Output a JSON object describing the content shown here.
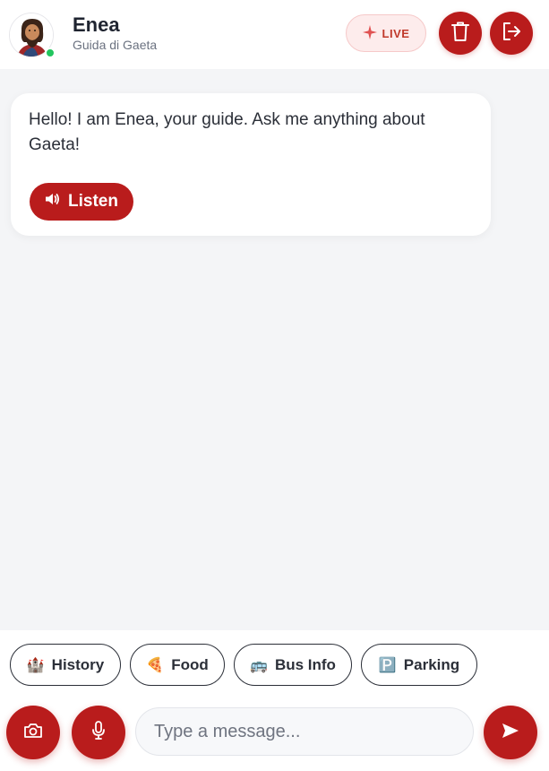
{
  "header": {
    "name": "Enea",
    "subtitle": "Guida di Gaeta",
    "live_label": "LIVE",
    "online": true
  },
  "chat": {
    "messages": [
      {
        "sender": "bot",
        "text": "Hello! I am Enea, your guide. Ask me anything about Gaeta!",
        "listen_label": "Listen"
      }
    ]
  },
  "quick_replies": [
    {
      "emoji": "🏰",
      "label": "History"
    },
    {
      "emoji": "🍕",
      "label": "Food"
    },
    {
      "emoji": "🚌",
      "label": "Bus Info"
    },
    {
      "emoji": "🅿️",
      "label": "Parking"
    }
  ],
  "composer": {
    "placeholder": "Type a message..."
  },
  "colors": {
    "accent": "#b91c1c",
    "online": "#22c55e",
    "background": "#f4f5f7"
  },
  "icons": {
    "live": "sparkle-icon",
    "delete": "trash-icon",
    "exit": "logout-icon",
    "listen": "speaker-icon",
    "camera": "camera-icon",
    "mic": "microphone-icon",
    "send": "send-icon"
  }
}
